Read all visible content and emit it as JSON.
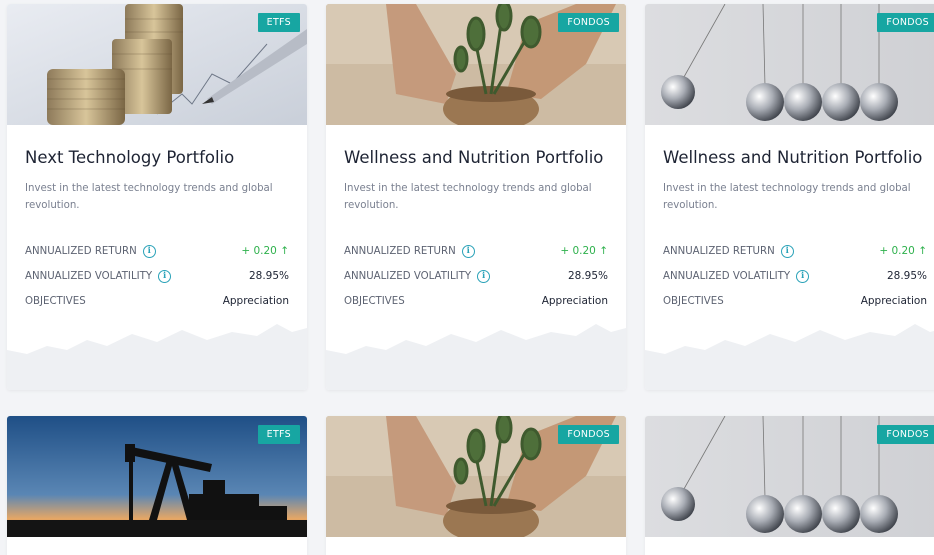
{
  "cards": [
    {
      "badge": "ETFS",
      "title": "Next Technology Portfolio",
      "desc": "Invest in the latest technology trends and global revolution.",
      "ret_label": "ANNUALIZED RETURN",
      "ret_value": "+ 0.20 ↑",
      "vol_label": "ANNUALIZED VOLATILITY",
      "vol_value": "28.95%",
      "obj_label": "OBJECTIVES",
      "obj_value": "Appreciation"
    },
    {
      "badge": "FONDOS",
      "title": "Wellness and Nutrition Portfolio",
      "desc": "Invest in the latest technology trends and global revolution.",
      "ret_label": "ANNUALIZED RETURN",
      "ret_value": "+ 0.20 ↑",
      "vol_label": "ANNUALIZED VOLATILITY",
      "vol_value": "28.95%",
      "obj_label": "OBJECTIVES",
      "obj_value": "Appreciation"
    },
    {
      "badge": "FONDOS",
      "title": "Wellness and Nutrition Portfolio",
      "desc": "Invest in the latest technology trends and global revolution.",
      "ret_label": "ANNUALIZED RETURN",
      "ret_value": "+ 0.20 ↑",
      "vol_label": "ANNUALIZED VOLATILITY",
      "vol_value": "28.95%",
      "obj_label": "OBJECTIVES",
      "obj_value": "Appreciation"
    },
    {
      "badge": "ETFS"
    },
    {
      "badge": "FONDOS"
    },
    {
      "badge": "FONDOS"
    }
  ],
  "colors": {
    "badge": "#17a6a2",
    "positive": "#2fb14d",
    "info_icon": "#2aa2b8"
  },
  "icons": [
    "coins-pen-image",
    "plant-pot-image",
    "newtons-cradle-image",
    "oil-pump-image",
    "info-icon",
    "arrow-up-icon",
    "sparkline"
  ]
}
